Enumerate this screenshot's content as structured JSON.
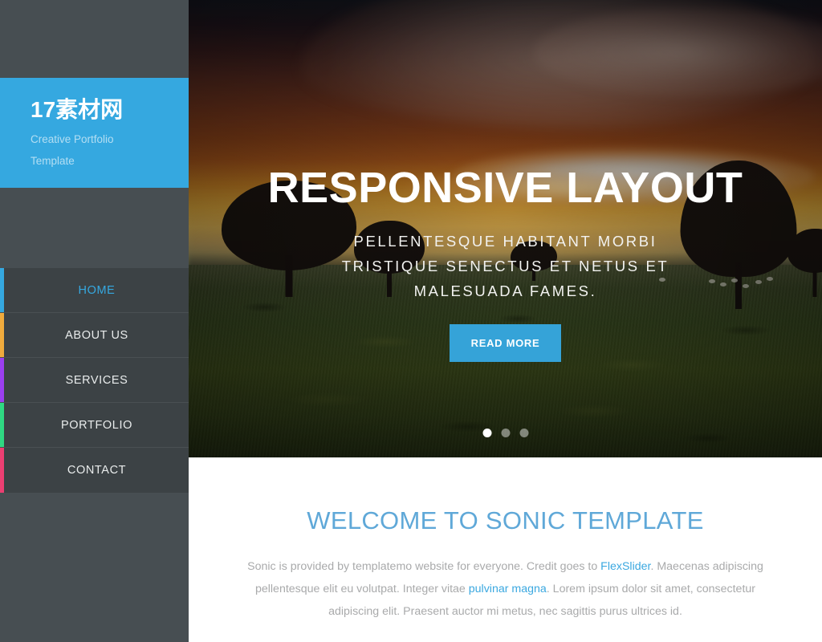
{
  "sidebar": {
    "logo": {
      "title": "17素材网",
      "subtitle_line1": "Creative Portfolio",
      "subtitle_line2": "Template",
      "background_color": "#35a8e0"
    },
    "nav_items": [
      {
        "label": "HOME",
        "accent_color": "#35a8e0",
        "active": true
      },
      {
        "label": "ABOUT US",
        "accent_color": "#f0ab3d",
        "active": false
      },
      {
        "label": "SERVICES",
        "accent_color": "#9b3ff0",
        "active": false
      },
      {
        "label": "PORTFOLIO",
        "accent_color": "#2fd882",
        "active": false
      },
      {
        "label": "CONTACT",
        "accent_color": "#ec3f72",
        "active": false
      }
    ],
    "background_color": "#474e52",
    "nav_background_color": "#3c4245"
  },
  "hero": {
    "title": "RESPONSIVE LAYOUT",
    "subtitle": "Pellentesque habitant morbi tristique senectus et netus et malesuada fames.",
    "cta_label": "READ MORE",
    "cta_color": "#35a3d8",
    "slides": [
      {
        "index": 1,
        "active": true
      },
      {
        "index": 2,
        "active": false
      },
      {
        "index": 3,
        "active": false
      }
    ]
  },
  "welcome": {
    "title": "WELCOME TO SONIC TEMPLATE",
    "title_color": "#5fa8d8",
    "paragraph_part1": "Sonic is provided by templatemo website for everyone. Credit goes to ",
    "link1": "FlexSlider",
    "paragraph_part2": ". Maecenas adipiscing pellentesque elit eu volutpat. Integer vitae ",
    "link2": "pulvinar magna",
    "paragraph_part3": ". Lorem ipsum dolor sit amet, consectetur adipiscing elit. Praesent auctor mi metus, nec sagittis purus ultrices id.",
    "link_color": "#3ba8e0"
  }
}
